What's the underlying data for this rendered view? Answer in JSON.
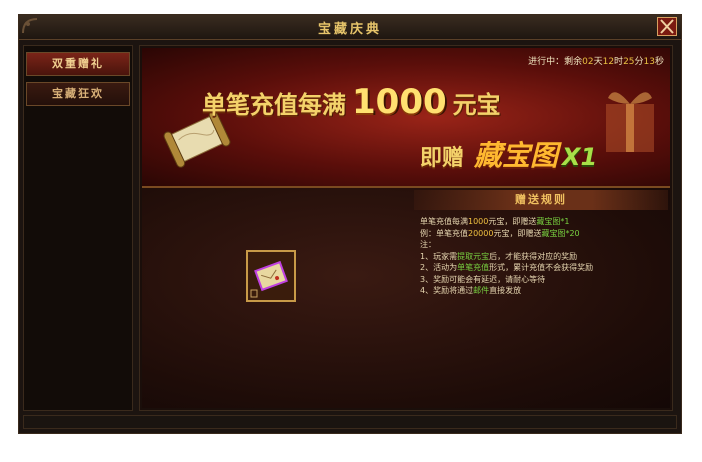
{
  "window": {
    "title": "宝藏庆典"
  },
  "sidebar": {
    "items": [
      {
        "label": "双重赠礼"
      },
      {
        "label": "宝藏狂欢"
      }
    ]
  },
  "banner": {
    "status_prefix": "进行中：剩余",
    "days": "02",
    "days_unit": "天",
    "hours": "12",
    "hours_unit": "时",
    "minutes": "25",
    "minutes_unit": "分",
    "seconds": "13",
    "seconds_unit": "秒",
    "headline_pre": "单笔充值每满",
    "headline_amount": "1000",
    "headline_post": "元宝",
    "sub_prefix": "即赠",
    "sub_item": "藏宝图",
    "sub_qty": "X1"
  },
  "rules": {
    "header": "赠送规则",
    "l1_a": "单笔充值每满",
    "l1_b": "1000",
    "l1_c": "元宝，即赠送",
    "l1_d": "藏宝图*1",
    "l2_a": "例：单笔充值",
    "l2_b": "20000",
    "l2_c": "元宝，即赠送",
    "l2_d": "藏宝图*20",
    "l3": "注：",
    "l4_a": "1、玩家需",
    "l4_b": "提取元宝",
    "l4_c": "后，才能获得对应的奖励",
    "l5_a": "2、活动为",
    "l5_b": "单笔充值",
    "l5_c": "形式，累计充值不会获得奖励",
    "l6": "3、奖励可能会有延迟，请耐心等待",
    "l7_a": "4、奖励将通过",
    "l7_b": "邮件",
    "l7_c": "直接发放"
  },
  "colors": {
    "accent_gold": "#f4d26a",
    "highlight_green": "#78d040",
    "highlight_yellow": "#f0c040",
    "banner_red": "#9a2418"
  },
  "icons": {
    "close": "close-icon",
    "treasure_map": "treasure-map-icon",
    "scroll": "scroll-icon",
    "gift": "gift-box-icon"
  }
}
